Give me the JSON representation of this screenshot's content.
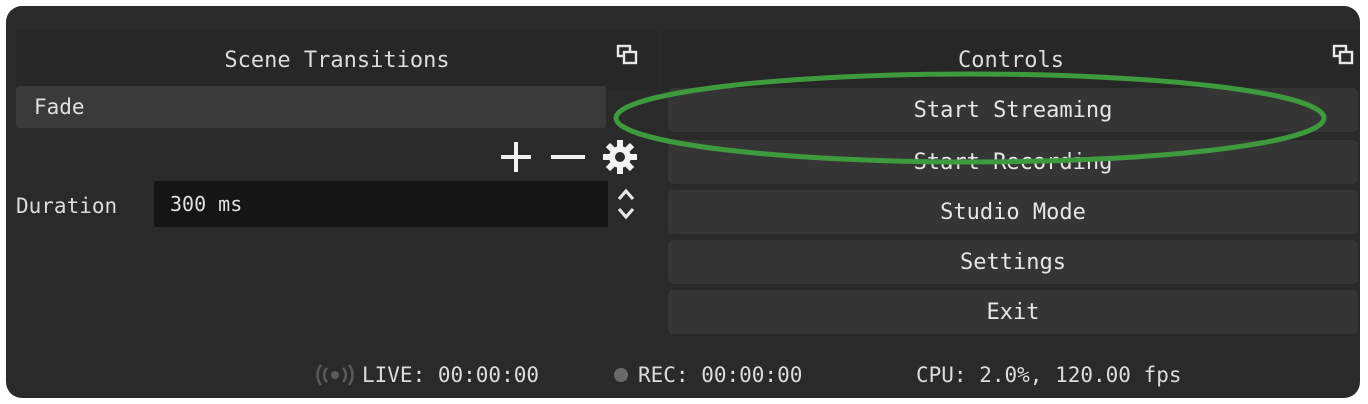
{
  "scene_transitions": {
    "title": "Scene Transitions",
    "selected_transition": "Fade",
    "duration_label": "Duration",
    "duration_value": "300 ms"
  },
  "controls": {
    "title": "Controls",
    "buttons": [
      {
        "label": "Start Streaming"
      },
      {
        "label": "Start Recording"
      },
      {
        "label": "Studio Mode"
      },
      {
        "label": "Settings"
      },
      {
        "label": "Exit"
      }
    ]
  },
  "statusbar": {
    "live": "LIVE: 00:00:00",
    "rec": "REC: 00:00:00",
    "cpu": "CPU: 2.0%, 120.00 fps"
  },
  "icons": [
    "dock-float-icon",
    "plus-icon",
    "minus-icon",
    "gear-icon",
    "spinner-arrows-icon",
    "live-broadcast-icon",
    "record-dot-icon"
  ],
  "colors": {
    "background": "#2a2a2a",
    "button": "#353535",
    "input": "#151515",
    "highlight": "#3d9a3d"
  }
}
